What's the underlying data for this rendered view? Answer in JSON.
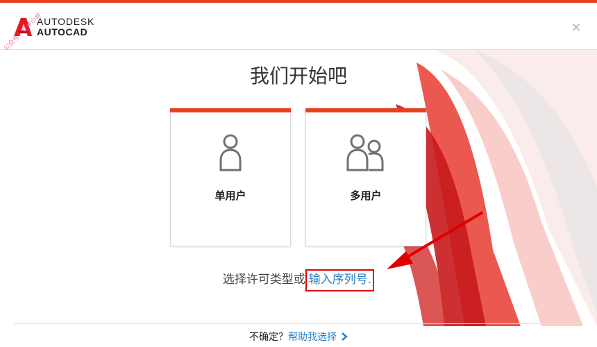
{
  "header": {
    "brand_line1": "AUTODESK",
    "brand_line2": "AUTOCAD",
    "watermark": "公众号：软件小井",
    "close_icon": "close-icon",
    "close_glyph": "×"
  },
  "main": {
    "title": "我们开始吧",
    "cards": [
      {
        "label": "单用户",
        "icon": "single-user-icon"
      },
      {
        "label": "多用户",
        "icon": "multi-user-icon"
      }
    ],
    "license_prompt": "选择许可类型或",
    "serial_link": "输入序列号",
    "license_suffix": "."
  },
  "footer": {
    "question": "不确定？",
    "help_link": "帮助我选择",
    "chevron_icon": "chevron-right-icon"
  },
  "colors": {
    "accent": "#e8401c",
    "link": "#2a82c6",
    "highlight_box": "#e00000"
  }
}
